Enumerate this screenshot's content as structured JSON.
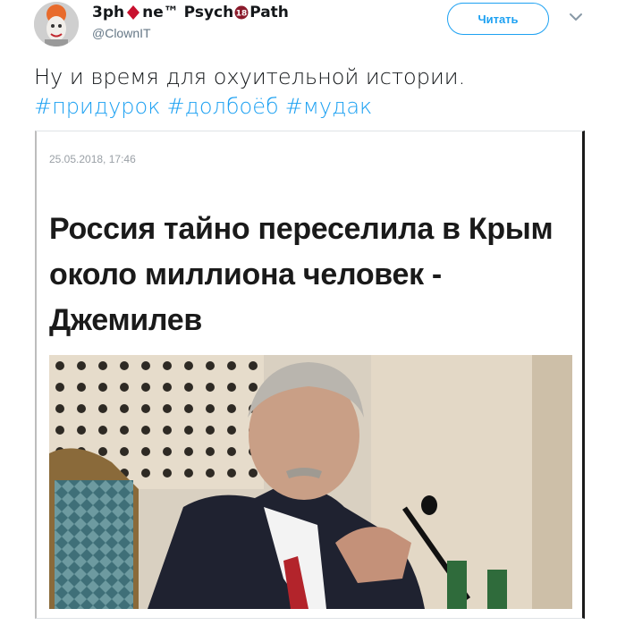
{
  "user": {
    "name_part1": "3ph",
    "name_part2": "ne™ Psych",
    "name_part3": "Path",
    "handle": "@ClownIT",
    "avatar_icon": "clown-avatar"
  },
  "follow_button": {
    "label": "Читать"
  },
  "menu": {
    "icon": "chevron-down-icon"
  },
  "tweet": {
    "text": "Ну и время для охуительной истории.",
    "hashtags": [
      "#придурок",
      "#долбоёб",
      "#мудак"
    ]
  },
  "article": {
    "date": "25.05.2018, 17:46",
    "title": "Россия тайно переселила в Крым около миллиона человек - Джемилев"
  },
  "colors": {
    "accent": "#1da1f2",
    "diamond": "#c8102e",
    "badge": "#8b1a2b"
  }
}
